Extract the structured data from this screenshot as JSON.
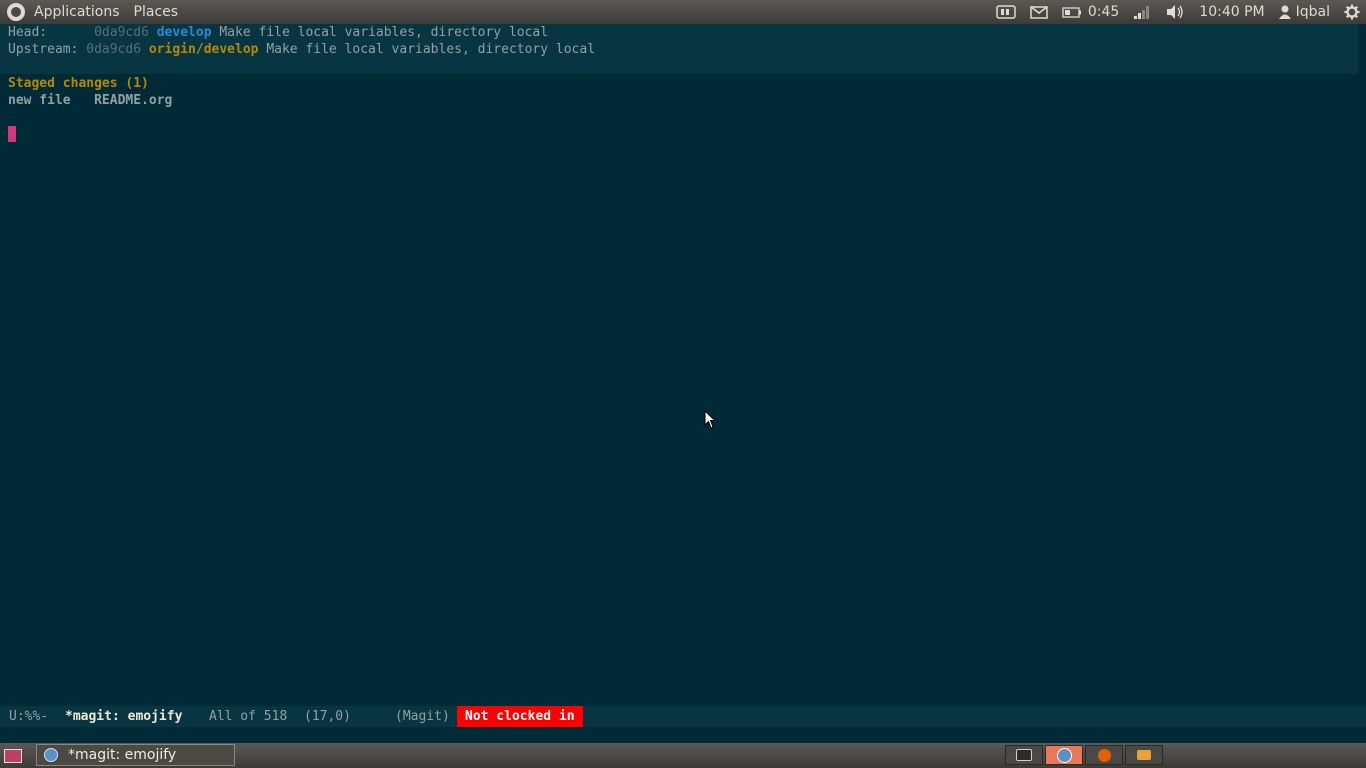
{
  "top_panel": {
    "menus": [
      "Applications",
      "Places"
    ],
    "battery_time": "0:45",
    "clock": "10:40 PM",
    "user": "Iqbal"
  },
  "magit": {
    "head_label": "Head:",
    "head_hash": "0da9cd6",
    "head_branch": "develop",
    "head_message": "Make file local variables, directory local",
    "upstream_label": "Upstream:",
    "upstream_hash": "0da9cd6",
    "upstream_branch": "origin/develop",
    "upstream_message": "Make file local variables, directory local",
    "staged_heading": "Staged changes (1)",
    "staged_files": [
      {
        "status": "new file",
        "name": "README.org"
      }
    ]
  },
  "mode_line": {
    "status": "U:%%-",
    "buffer_name": "*magit: emojify",
    "position": "All of 518",
    "line_col": "(17,0)",
    "mode": "(Magit)",
    "clock_status": "Not clocked in"
  },
  "bottom_panel": {
    "task_title": "*magit: emojify"
  },
  "colors": {
    "background": "#002b36",
    "header_bg": "#073642",
    "branch_local": "#268bd2",
    "branch_remote": "#b58900",
    "cursor": "#d33682",
    "clock_badge": "#ff0000"
  }
}
